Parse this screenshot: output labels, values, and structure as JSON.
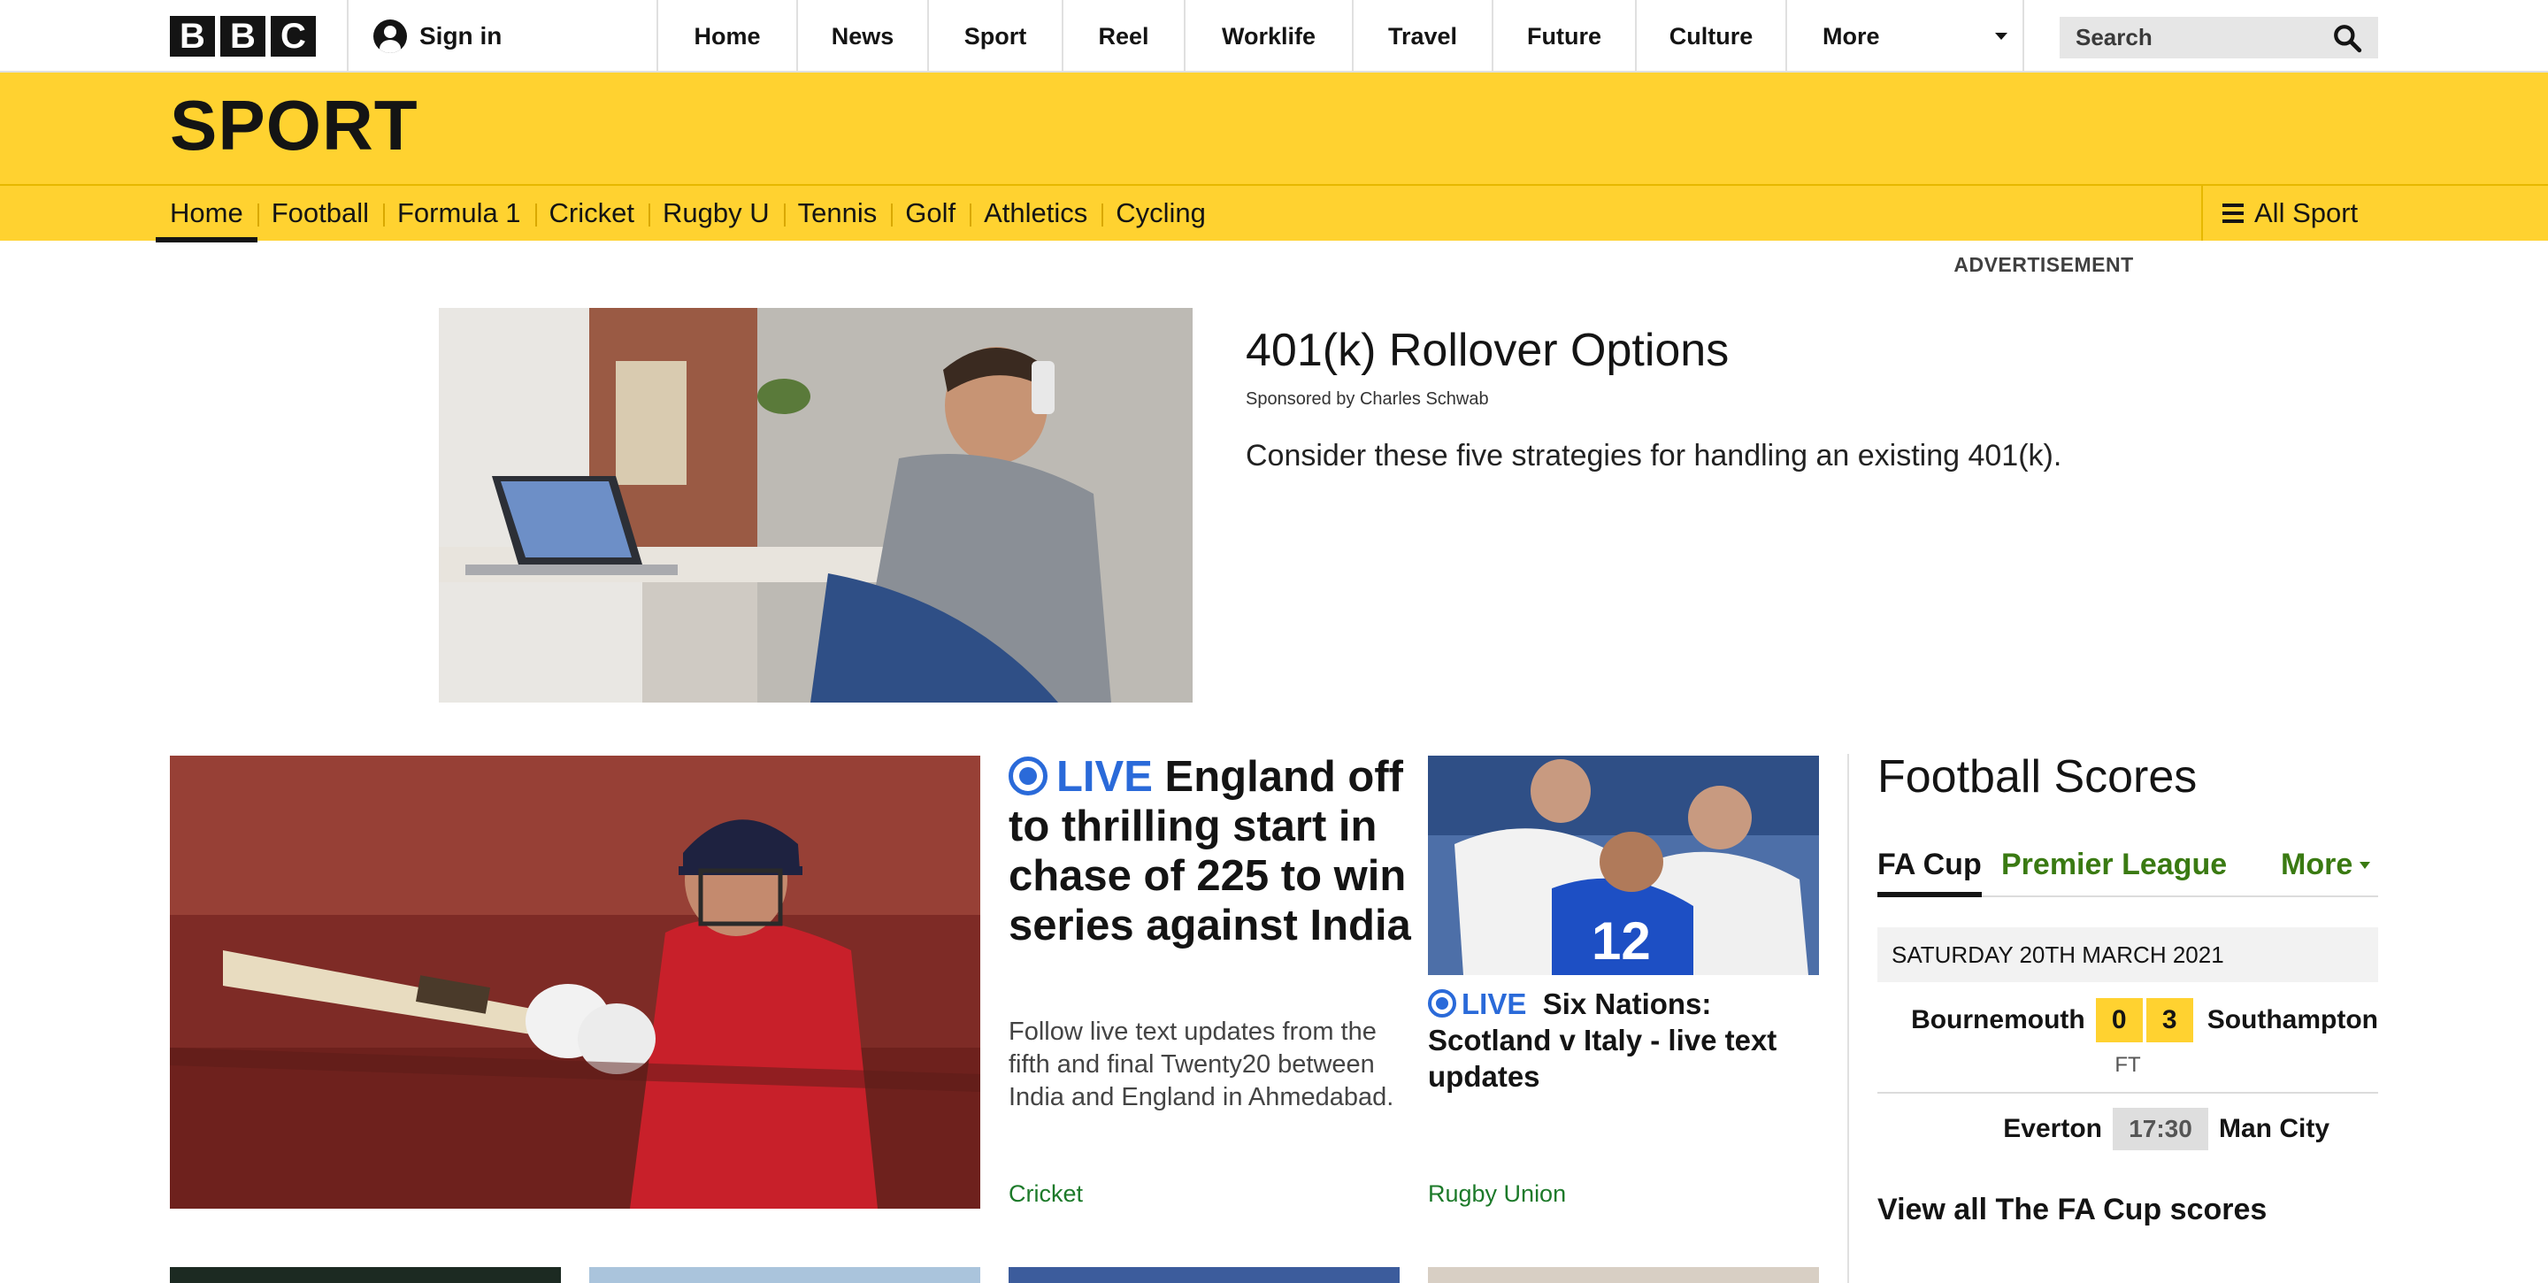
{
  "brand": {
    "letters": [
      "B",
      "B",
      "C"
    ]
  },
  "account": {
    "signin_label": "Sign in"
  },
  "top_nav": {
    "items": [
      "Home",
      "News",
      "Sport",
      "Reel",
      "Worklife",
      "Travel",
      "Future",
      "Culture"
    ],
    "more_label": "More"
  },
  "search": {
    "placeholder": "Search"
  },
  "section": {
    "title": "SPORT",
    "nav": [
      "Home",
      "Football",
      "Formula 1",
      "Cricket",
      "Rugby U",
      "Tennis",
      "Golf",
      "Athletics",
      "Cycling"
    ],
    "active_nav": "Home",
    "all_sport_label": "All Sport"
  },
  "advert": {
    "label": "ADVERTISEMENT",
    "title": "401(k) Rollover Options",
    "sponsor": "Sponsored by Charles Schwab",
    "description": "Consider these five strategies for handling an existing 401(k)."
  },
  "lead_story": {
    "live_label": "LIVE",
    "headline": "England off to thrilling start in chase of 225 to win series against India",
    "summary": "Follow live text updates from the fifth and final Twenty20 between India and England in Ahmedabad.",
    "tag": "Cricket"
  },
  "second_story": {
    "live_label": "LIVE",
    "headline": "Six Nations: Scotland v Italy - live text updates",
    "tag": "Rugby Union"
  },
  "scores": {
    "title": "Football Scores",
    "tabs": [
      "FA Cup",
      "Premier League"
    ],
    "more_label": "More",
    "date": "SATURDAY 20TH MARCH 2021",
    "match1": {
      "home": "Bournemouth",
      "home_score": "0",
      "away_score": "3",
      "away": "Southampton",
      "status": "FT"
    },
    "match2": {
      "home": "Everton",
      "time": "17:30",
      "away": "Man City"
    },
    "view_all": "View all The FA Cup scores"
  },
  "colors": {
    "sport_yellow": "#ffd230",
    "live_blue": "#2a6ad9",
    "tag_green": "#1d7a2a",
    "tab_green": "#3a7a12"
  }
}
